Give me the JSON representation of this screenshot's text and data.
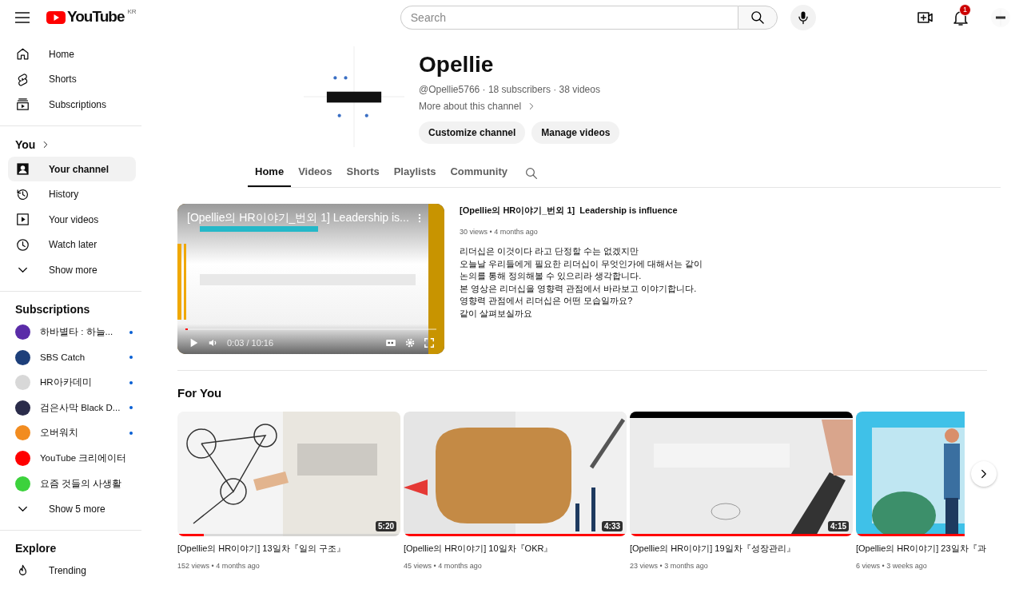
{
  "header": {
    "logo": "YouTube",
    "region": "KR",
    "search": {
      "placeholder": "Search"
    },
    "notifications": "1"
  },
  "sidebar": {
    "main": [
      {
        "label": "Home",
        "kind": "home",
        "selected": false
      },
      {
        "label": "Shorts",
        "kind": "shorts",
        "selected": false
      },
      {
        "label": "Subscriptions",
        "kind": "subs",
        "selected": false
      }
    ],
    "you": {
      "title": "You",
      "items": [
        {
          "label": "Your channel",
          "kind": "person",
          "selected": true
        },
        {
          "label": "History",
          "kind": "history",
          "selected": false
        },
        {
          "label": "Your videos",
          "kind": "play",
          "selected": false
        },
        {
          "label": "Watch later",
          "kind": "clock",
          "selected": false
        },
        {
          "label": "Show more",
          "kind": "chevron",
          "selected": false
        }
      ]
    },
    "subscriptions": {
      "title": "Subscriptions",
      "items": [
        {
          "name": "하바별타 : 하늘...",
          "color": "#5a2ca8",
          "new": true
        },
        {
          "name": "SBS Catch",
          "color": "#1d3f7a",
          "new": true
        },
        {
          "name": "HR아카데미",
          "color": "#d8d8d8",
          "new": true
        },
        {
          "name": "검은사막 Black D...",
          "color": "#2a2c4a",
          "new": true
        },
        {
          "name": "오버워치",
          "color": "#f28c20",
          "new": true
        },
        {
          "name": "YouTube 크리에이터",
          "color": "#ff0000",
          "new": false
        },
        {
          "name": "요즘 것들의 사생활",
          "color": "#3cd23c",
          "new": false
        }
      ],
      "more": "Show 5 more"
    },
    "explore": {
      "title": "Explore",
      "items": [
        {
          "label": "Trending",
          "kind": "fire"
        }
      ]
    }
  },
  "channel": {
    "name": "Opellie",
    "meta": "@Opellie5766 · 18 subscribers · 38 videos",
    "more": "More about this channel",
    "buttons": [
      "Customize channel",
      "Manage videos"
    ],
    "tabs": [
      {
        "label": "Home",
        "selected": true
      },
      {
        "label": "Videos",
        "selected": false
      },
      {
        "label": "Shorts",
        "selected": false
      },
      {
        "label": "Playlists",
        "selected": false
      },
      {
        "label": "Community",
        "selected": false
      }
    ]
  },
  "featured": {
    "player_title": "[Opellie의 HR이야기_번외 1] Leadership is...",
    "time": "0:03 / 10:16",
    "level": 0.01,
    "title": "[Opellie의 HR이야기_번외 1]  Leadership is influence",
    "meta": "30 views • 4 months ago",
    "description": [
      "리더십은 이것이다 라고 단정할 수는 없겠지만",
      "오늘날 우리들에게 필요한 리더십이 무엇인가에 대해서는 같이",
      "논의를 통해 정의해볼 수 있으리라 생각합니다.",
      "본 영상은 리더십을 영향력 관점에서 바라보고 이야기합니다.",
      "영향력 관점에서 리더십은 어떤 모습일까요?",
      "같이 살펴보실까요"
    ]
  },
  "shelf": {
    "title": "For You",
    "videos": [
      {
        "title": "[Opellie의 HR이야기] 13일차『일의 구조』",
        "meta": "152 views • 4 months ago",
        "duration": "5:20",
        "level": 0.12
      },
      {
        "title": "[Opellie의 HR이야기] 10일차『OKR』",
        "meta": "45 views • 4 months ago",
        "duration": "4:33",
        "level": 1
      },
      {
        "title": "[Opellie의 HR이야기] 19일차『성장관리』",
        "meta": "23 views • 3 months ago",
        "duration": "4:15",
        "level": 1
      },
      {
        "title": "[Opellie의 HR이야기] 23일차『과",
        "meta": "6 views • 3 weeks ago",
        "level": 1
      }
    ]
  }
}
